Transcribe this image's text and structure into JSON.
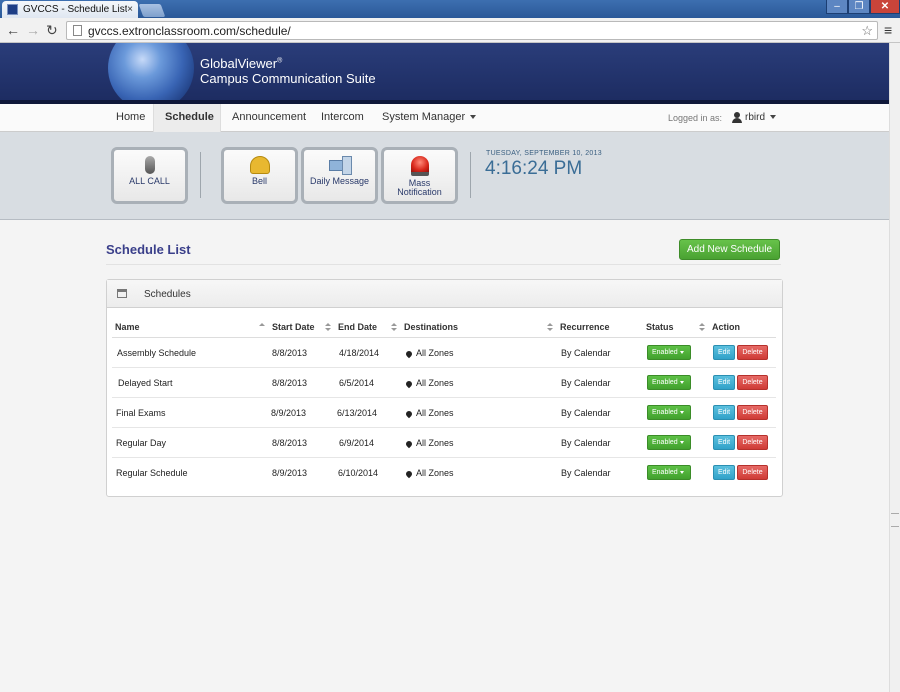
{
  "browser": {
    "tab_title": "GVCCS - Schedule List",
    "tab_close": "×",
    "url": "gvccs.extronclassroom.com/schedule/",
    "win_min": "–",
    "win_max": "❐",
    "win_close": "✕",
    "back": "←",
    "forward": "→",
    "reload": "↻",
    "star": "☆",
    "menu": "≡"
  },
  "brand": {
    "line1": "GlobalViewer",
    "line1_mark": "®",
    "line2": "Campus Communication Suite"
  },
  "nav": {
    "items": [
      "Home",
      "Schedule",
      "Announcement",
      "Intercom",
      "System Manager"
    ],
    "active": "Schedule",
    "logged_in_label": "Logged in as:",
    "user": "rbird"
  },
  "quick_actions": [
    {
      "label": "ALL CALL",
      "icon": "microphone-icon"
    },
    {
      "label": "Bell",
      "icon": "bell-icon"
    },
    {
      "label": "Daily Message",
      "icon": "megaphone-icon"
    },
    {
      "label": "Mass Notification",
      "icon": "siren-icon"
    }
  ],
  "datetime": {
    "date": "TUESDAY, SEPTEMBER 10, 2013",
    "time": "4:16:24 PM"
  },
  "page": {
    "title": "Schedule List",
    "add_button": "Add New Schedule",
    "panel_title": "Schedules"
  },
  "table": {
    "headers": [
      "Name",
      "Start Date",
      "End Date",
      "Destinations",
      "Recurrence",
      "Status",
      "Action"
    ],
    "rows": [
      {
        "name": "Assembly Schedule",
        "start": "8/8/2013",
        "end": "4/18/2014",
        "dest": "All Zones",
        "recurrence": "By Calendar",
        "status": "Enabled"
      },
      {
        "name": "Delayed Start",
        "start": "8/8/2013",
        "end": "6/5/2014",
        "dest": "All Zones",
        "recurrence": "By Calendar",
        "status": "Enabled"
      },
      {
        "name": "Final Exams",
        "start": "8/9/2013",
        "end": "6/13/2014",
        "dest": "All Zones",
        "recurrence": "By Calendar",
        "status": "Enabled"
      },
      {
        "name": "Regular Day",
        "start": "8/8/2013",
        "end": "6/9/2014",
        "dest": "All Zones",
        "recurrence": "By Calendar",
        "status": "Enabled"
      },
      {
        "name": "Regular Schedule",
        "start": "8/9/2013",
        "end": "6/10/2014",
        "dest": "All Zones",
        "recurrence": "By Calendar",
        "status": "Enabled"
      }
    ],
    "edit_label": "Edit",
    "delete_label": "Delete"
  },
  "colors": {
    "brand_blue": "#1c2b60",
    "title_color": "#3a3f8a",
    "success_green": "#4aa232",
    "info_blue": "#31a2c9",
    "danger_red": "#cf3b36"
  }
}
